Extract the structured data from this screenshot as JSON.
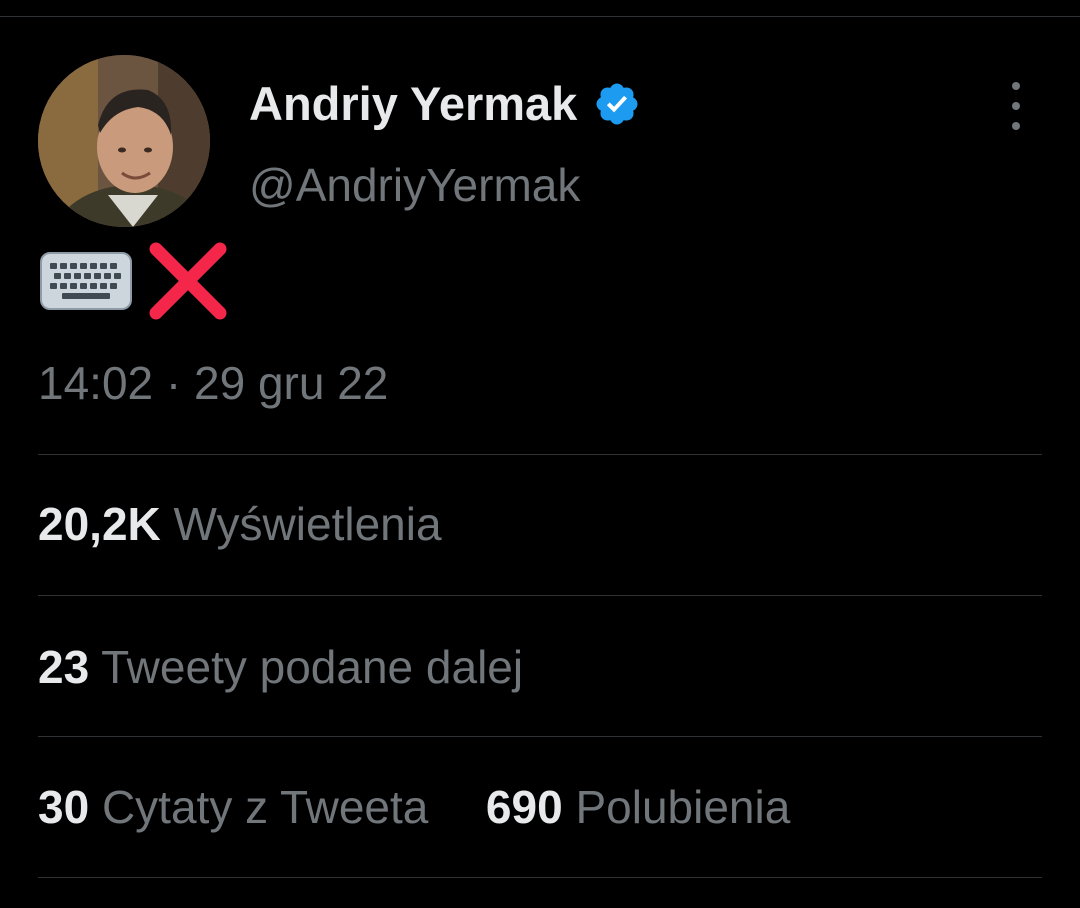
{
  "tweet": {
    "author": {
      "display_name": "Andriy Yermak",
      "handle": "@AndriyYermak",
      "verified": true
    },
    "more_icon": "more-vertical-icon",
    "content": {
      "emojis": [
        "keyboard-emoji",
        "cross-mark-emoji"
      ]
    },
    "timestamp": "14:02 · 29 gru 22",
    "stats": {
      "views": {
        "value": "20,2K",
        "label": "Wyświetlenia"
      },
      "retweets": {
        "value": "23",
        "label": "Tweety podane dalej"
      },
      "quotes": {
        "value": "30",
        "label": "Cytaty z Tweeta"
      },
      "likes": {
        "value": "690",
        "label": "Polubienia"
      }
    }
  },
  "colors": {
    "background": "#000000",
    "primary_text": "#e7e9ea",
    "secondary_text": "#71767b",
    "divider": "#2f3336",
    "verified_badge": "#1d9bf0",
    "cross_mark": "#f4264a"
  }
}
